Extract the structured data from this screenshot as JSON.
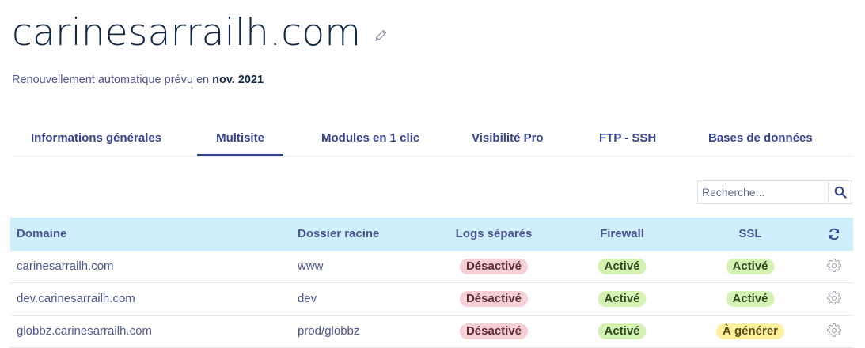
{
  "header": {
    "title": "carinesarrailh.com",
    "renewal_prefix": "Renouvellement automatique prévu en ",
    "renewal_date": "nov. 2021"
  },
  "tabs": [
    {
      "label": "Informations générales",
      "active": false
    },
    {
      "label": "Multisite",
      "active": true
    },
    {
      "label": "Modules en 1 clic",
      "active": false
    },
    {
      "label": "Visibilité Pro",
      "active": false
    },
    {
      "label": "FTP - SSH",
      "active": false
    },
    {
      "label": "Bases de données",
      "active": false
    }
  ],
  "search": {
    "placeholder": "Recherche..."
  },
  "table": {
    "columns": [
      "Domaine",
      "Dossier racine",
      "Logs séparés",
      "Firewall",
      "SSL"
    ],
    "rows": [
      {
        "domain": "carinesarrailh.com",
        "folder": "www",
        "logs": "Désactivé",
        "firewall": "Activé",
        "ssl": "Activé"
      },
      {
        "domain": "dev.carinesarrailh.com",
        "folder": "dev",
        "logs": "Désactivé",
        "firewall": "Activé",
        "ssl": "Activé"
      },
      {
        "domain": "globbz.carinesarrailh.com",
        "folder": "prod/globbz",
        "logs": "Désactivé",
        "firewall": "Activé",
        "ssl": "À générer"
      }
    ]
  },
  "icons": {
    "edit": "pencil-icon",
    "search": "search-icon",
    "refresh": "refresh-icon",
    "row_settings": "gear-icon"
  },
  "colors": {
    "header_bg": "#cfeefc",
    "tab_active": "#354291",
    "badge_disabled": "#f6d0d3",
    "badge_enabled": "#d6f1b4",
    "badge_pending": "#fff0a0"
  }
}
